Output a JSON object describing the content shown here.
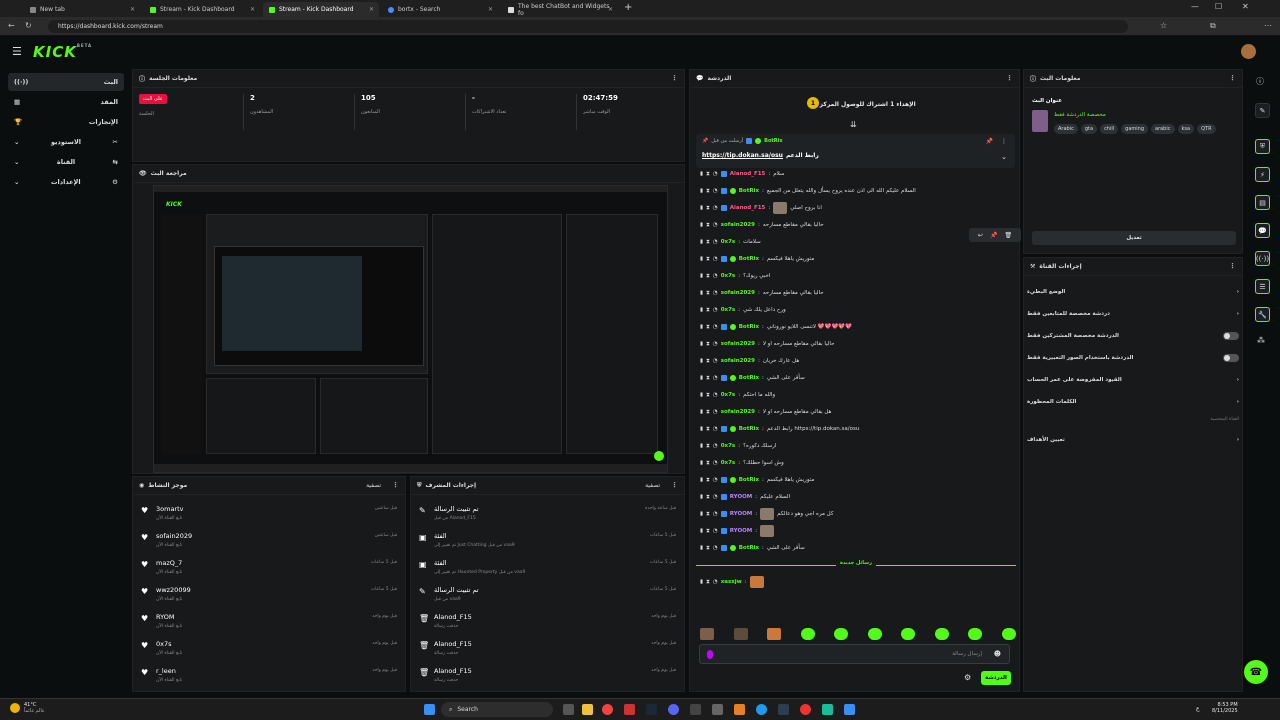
{
  "browser": {
    "tabs": [
      {
        "title": "New tab",
        "active": false
      },
      {
        "title": "Stream - Kick Dashboard",
        "active": false
      },
      {
        "title": "Stream - Kick Dashboard",
        "active": true
      },
      {
        "title": "bortx - Search",
        "active": false
      },
      {
        "title": "The best ChatBot and Widgets fo",
        "active": false
      }
    ],
    "url": "https://dashboard.kick.com/stream"
  },
  "brand": {
    "logo": "KICK",
    "beta": "BETA",
    "accent": "#53fc18"
  },
  "sidebar": {
    "items": [
      {
        "label": "البث",
        "icon": "broadcast-icon"
      },
      {
        "label": "المقد",
        "icon": "dashboard-icon"
      },
      {
        "label": "الإنجازات",
        "icon": "trophy-icon"
      },
      {
        "label": "الاستوديو",
        "icon": "studio-icon"
      },
      {
        "label": "القناة",
        "icon": "channel-icon"
      },
      {
        "label": "الإعدادات",
        "icon": "gear-icon"
      }
    ]
  },
  "session": {
    "title": "معلومات الجلسة",
    "live_badge": "على البث",
    "live_label": "الجلسة",
    "stats": [
      {
        "value": "2",
        "label": "المشاهدون"
      },
      {
        "value": "105",
        "label": "المتابعون"
      },
      {
        "value": "-",
        "label": "تعداد الاشتراكات"
      },
      {
        "value": "02:47:59",
        "label": "الوقت مباشر"
      }
    ]
  },
  "preview": {
    "title": "مراجعة البث"
  },
  "activity": {
    "title": "موجز النشاط",
    "filter": "تصفية",
    "rows": [
      {
        "name": "3omartv",
        "sub": "تابع القناة الآن",
        "time": "قبل ساعتين"
      },
      {
        "name": "sofain2029",
        "sub": "تابع القناة الآن",
        "time": "قبل ساعتين"
      },
      {
        "name": "mazQ_7",
        "sub": "تابع القناة الآن",
        "time": "قبل 5 ساعات"
      },
      {
        "name": "wwz20099",
        "sub": "تابع القناة الآن",
        "time": "قبل 5 ساعات"
      },
      {
        "name": "RYOM",
        "sub": "تابع القناة الآن",
        "time": "قبل يوم واحد"
      },
      {
        "name": "0x7s",
        "sub": "تابع القناة الآن",
        "time": "قبل يوم واحد"
      },
      {
        "name": "r_leen",
        "sub": "تابع القناة الآن",
        "time": "قبل يوم واحد"
      }
    ]
  },
  "modactions": {
    "title": "إجراءات المشرف",
    "filter": "تصفية",
    "rows": [
      {
        "name": "تم تثبيت الرسالة",
        "sub": "من قبل Alanod_F15",
        "time": "قبل ساعة واحدة",
        "icon": "pin-icon"
      },
      {
        "name": "الفئة",
        "sub": "تم تغيير إلى Just Chatting من قبل vaa9",
        "time": "قبل 5 ساعات",
        "icon": "category-icon"
      },
      {
        "name": "الفئة",
        "sub": "تم تغيير إلى Haunted Property من قبل vaa9",
        "time": "قبل 5 ساعات",
        "icon": "category-icon"
      },
      {
        "name": "تم تثبيت الرسالة",
        "sub": "من قبل vaa9",
        "time": "قبل 5 ساعات",
        "icon": "pin-icon"
      },
      {
        "name": "Alanod_F15",
        "sub": "حذفت رسالة",
        "time": "قبل يوم واحد",
        "icon": "trash-icon"
      },
      {
        "name": "Alanod_F15",
        "sub": "حذفت رسالة",
        "time": "قبل يوم واحد",
        "icon": "trash-icon"
      },
      {
        "name": "Alanod_F15",
        "sub": "حذفت رسالة",
        "time": "قبل يوم واحد",
        "icon": "trash-icon"
      }
    ]
  },
  "chat": {
    "title": "الدردشة",
    "goal": "الإهداء 1 اشتراك للوصول المركز 1",
    "goal_num": "1",
    "pinned_by": "أرسلت من قبل",
    "pinned_user": "BotRix",
    "pinned_text": "رابط الدعم",
    "pinned_link": "https://tip.dokan.sa/osu",
    "messages": [
      {
        "user": "Alanod_F15",
        "color": "#ff5a8a",
        "text": "سلام"
      },
      {
        "user": "BotRix",
        "color": "#53fc18",
        "text": "السلام عليكم الله الى اذن عنده يروح يسأل والله يتعلل من الجميع"
      },
      {
        "user": "Alanod_F15",
        "color": "#ff5a8a",
        "text": "انا بروح اصلي"
      },
      {
        "user": "sofain2029",
        "color": "#53fc18",
        "text": "حاليا بقالي مقاطع مسارحه"
      },
      {
        "user": "0x7s",
        "color": "#53fc18",
        "text": "سلامات"
      },
      {
        "user": "BotRix",
        "color": "#53fc18",
        "text": "متوريش ياهلا فيكسم"
      },
      {
        "user": "0x7s",
        "color": "#53fc18",
        "text": "اخبي ريوك؟"
      },
      {
        "user": "sofain2029",
        "color": "#53fc18",
        "text": "حاليا بقالي مقاطع مسارحه"
      },
      {
        "user": "0x7s",
        "color": "#53fc18",
        "text": "ورح داعل يلك شي"
      },
      {
        "user": "BotRix",
        "color": "#53fc18",
        "text": "لاتنسى اللايو نوروناني 💖💖💖💖💖"
      },
      {
        "user": "sofain2029",
        "color": "#53fc18",
        "text": "حاليا بقالي مقاطع مسارحه او لا"
      },
      {
        "user": "sofain2029",
        "color": "#53fc18",
        "text": "هل عارك خريان"
      },
      {
        "user": "BotRix",
        "color": "#53fc18",
        "text": "سأقر على الشي"
      },
      {
        "user": "0x7s",
        "color": "#53fc18",
        "text": "والله ما احتكم"
      },
      {
        "user": "sofain2029",
        "color": "#53fc18",
        "text": "هل بقالي مقاطع مسارحه او لا"
      },
      {
        "user": "BotRix",
        "color": "#53fc18",
        "text": "رابط الدعم https://tip.dokan.sa/osu"
      },
      {
        "user": "0x7s",
        "color": "#53fc18",
        "text": "ارسلك دكوره؟"
      },
      {
        "user": "0x7s",
        "color": "#53fc18",
        "text": "وش اسوا حطلك؟"
      },
      {
        "user": "BotRix",
        "color": "#53fc18",
        "text": "متوريش ياهلا فيكسم"
      },
      {
        "user": "RYOOM",
        "color": "#b884ff",
        "text": "السلام عليكم"
      },
      {
        "user": "RYOOM",
        "color": "#b884ff",
        "text": "كل مره اجي وهو دعالكم"
      },
      {
        "user": "RYOOM",
        "color": "#b884ff",
        "text": ""
      },
      {
        "user": "BotRix",
        "color": "#53fc18",
        "text": "سأقر على الشي"
      }
    ],
    "new_messages": "رسائل جديدة",
    "last": {
      "user": "xasxjw",
      "color": "#53fc18",
      "text": ""
    },
    "input_placeholder": "إرسال رسالة",
    "send_label": "الدردشة"
  },
  "info": {
    "title": "معلومات البث",
    "stream_title_label": "عنوان البث",
    "category": "مخصصة الدردشة فقط",
    "tags": [
      "Arabic",
      "gta",
      "chill",
      "gaming",
      "arabic",
      "ksa",
      "QTR"
    ],
    "edit_label": "تعديل"
  },
  "channel_actions": {
    "title": "إجراءات القناة",
    "rows": [
      {
        "label": "الوضع البطيء",
        "control": "chevron"
      },
      {
        "label": "دردشة مخصصة للمتابعين فقط",
        "control": "chevron"
      },
      {
        "label": "الدردشة مخصصة المشتركين فقط",
        "control": "toggle"
      },
      {
        "label": "الدردشة باستخدام الصور التعبيرية فقط",
        "control": "toggle"
      },
      {
        "label": "القيود المفروضة على عمر الحساب",
        "control": "chevron"
      },
      {
        "label": "الكلمات المحظورة",
        "control": "chevron"
      }
    ],
    "section": "القناة الشخصية",
    "target": "تعيين الأهداف"
  },
  "taskbar": {
    "weather_temp": "41°C",
    "weather_text": "عالم غائماً",
    "search": "Search",
    "time": "8:53 PM",
    "date": "8/11/2025",
    "lang": "ع"
  }
}
